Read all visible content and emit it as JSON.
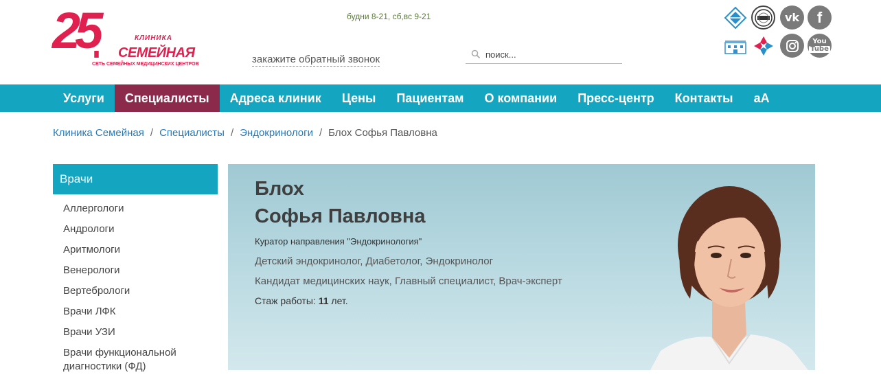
{
  "header": {
    "logo": {
      "number": "25",
      "clinic_word": "КЛИНИКА",
      "brand": "СЕМЕЙНАЯ",
      "tagline": "СЕТЬ СЕМЕЙНЫХ МЕДИЦИНСКИХ ЦЕНТРОВ",
      "color": "#e0204f"
    },
    "hours": "будни 8-21, сб,вс 9-21",
    "callback_link": "закажите обратный звонок",
    "search_placeholder": "поиск...",
    "social": {
      "vk": "vk",
      "facebook": "f",
      "youtube_top": "You",
      "youtube_bottom": "Tube"
    }
  },
  "nav": {
    "items": [
      "Услуги",
      "Специалисты",
      "Адреса клиник",
      "Цены",
      "Пациентам",
      "О компании",
      "Пресс-центр",
      "Контакты",
      "аА"
    ],
    "active_index": 1,
    "background": "#14a5c0",
    "active_background": "#8c2a4b"
  },
  "breadcrumb": {
    "items": [
      "Клиника Семейная",
      "Специалисты",
      "Эндокринологи"
    ],
    "separator": "/",
    "current": "Блох Софья Павловна"
  },
  "sidebar": {
    "title": "Врачи",
    "items": [
      "Аллергологи",
      "Андрологи",
      "Аритмологи",
      "Венерологи",
      "Вертебрологи",
      "Врачи ЛФК",
      "Врачи УЗИ",
      "Врачи функциональной диагностики (ФД)"
    ]
  },
  "doctor": {
    "last_name": "Блох",
    "first_names": "Софья Павловна",
    "curator": "Куратор направления \"Эндокринология\"",
    "specialties": "Детский эндокринолог, Диабетолог, Эндокринолог",
    "degrees": "Кандидат медицинских наук, Главный специалист, Врач-эксперт",
    "experience_label": "Стаж работы: ",
    "experience_value": "11",
    "experience_unit": " лет."
  }
}
